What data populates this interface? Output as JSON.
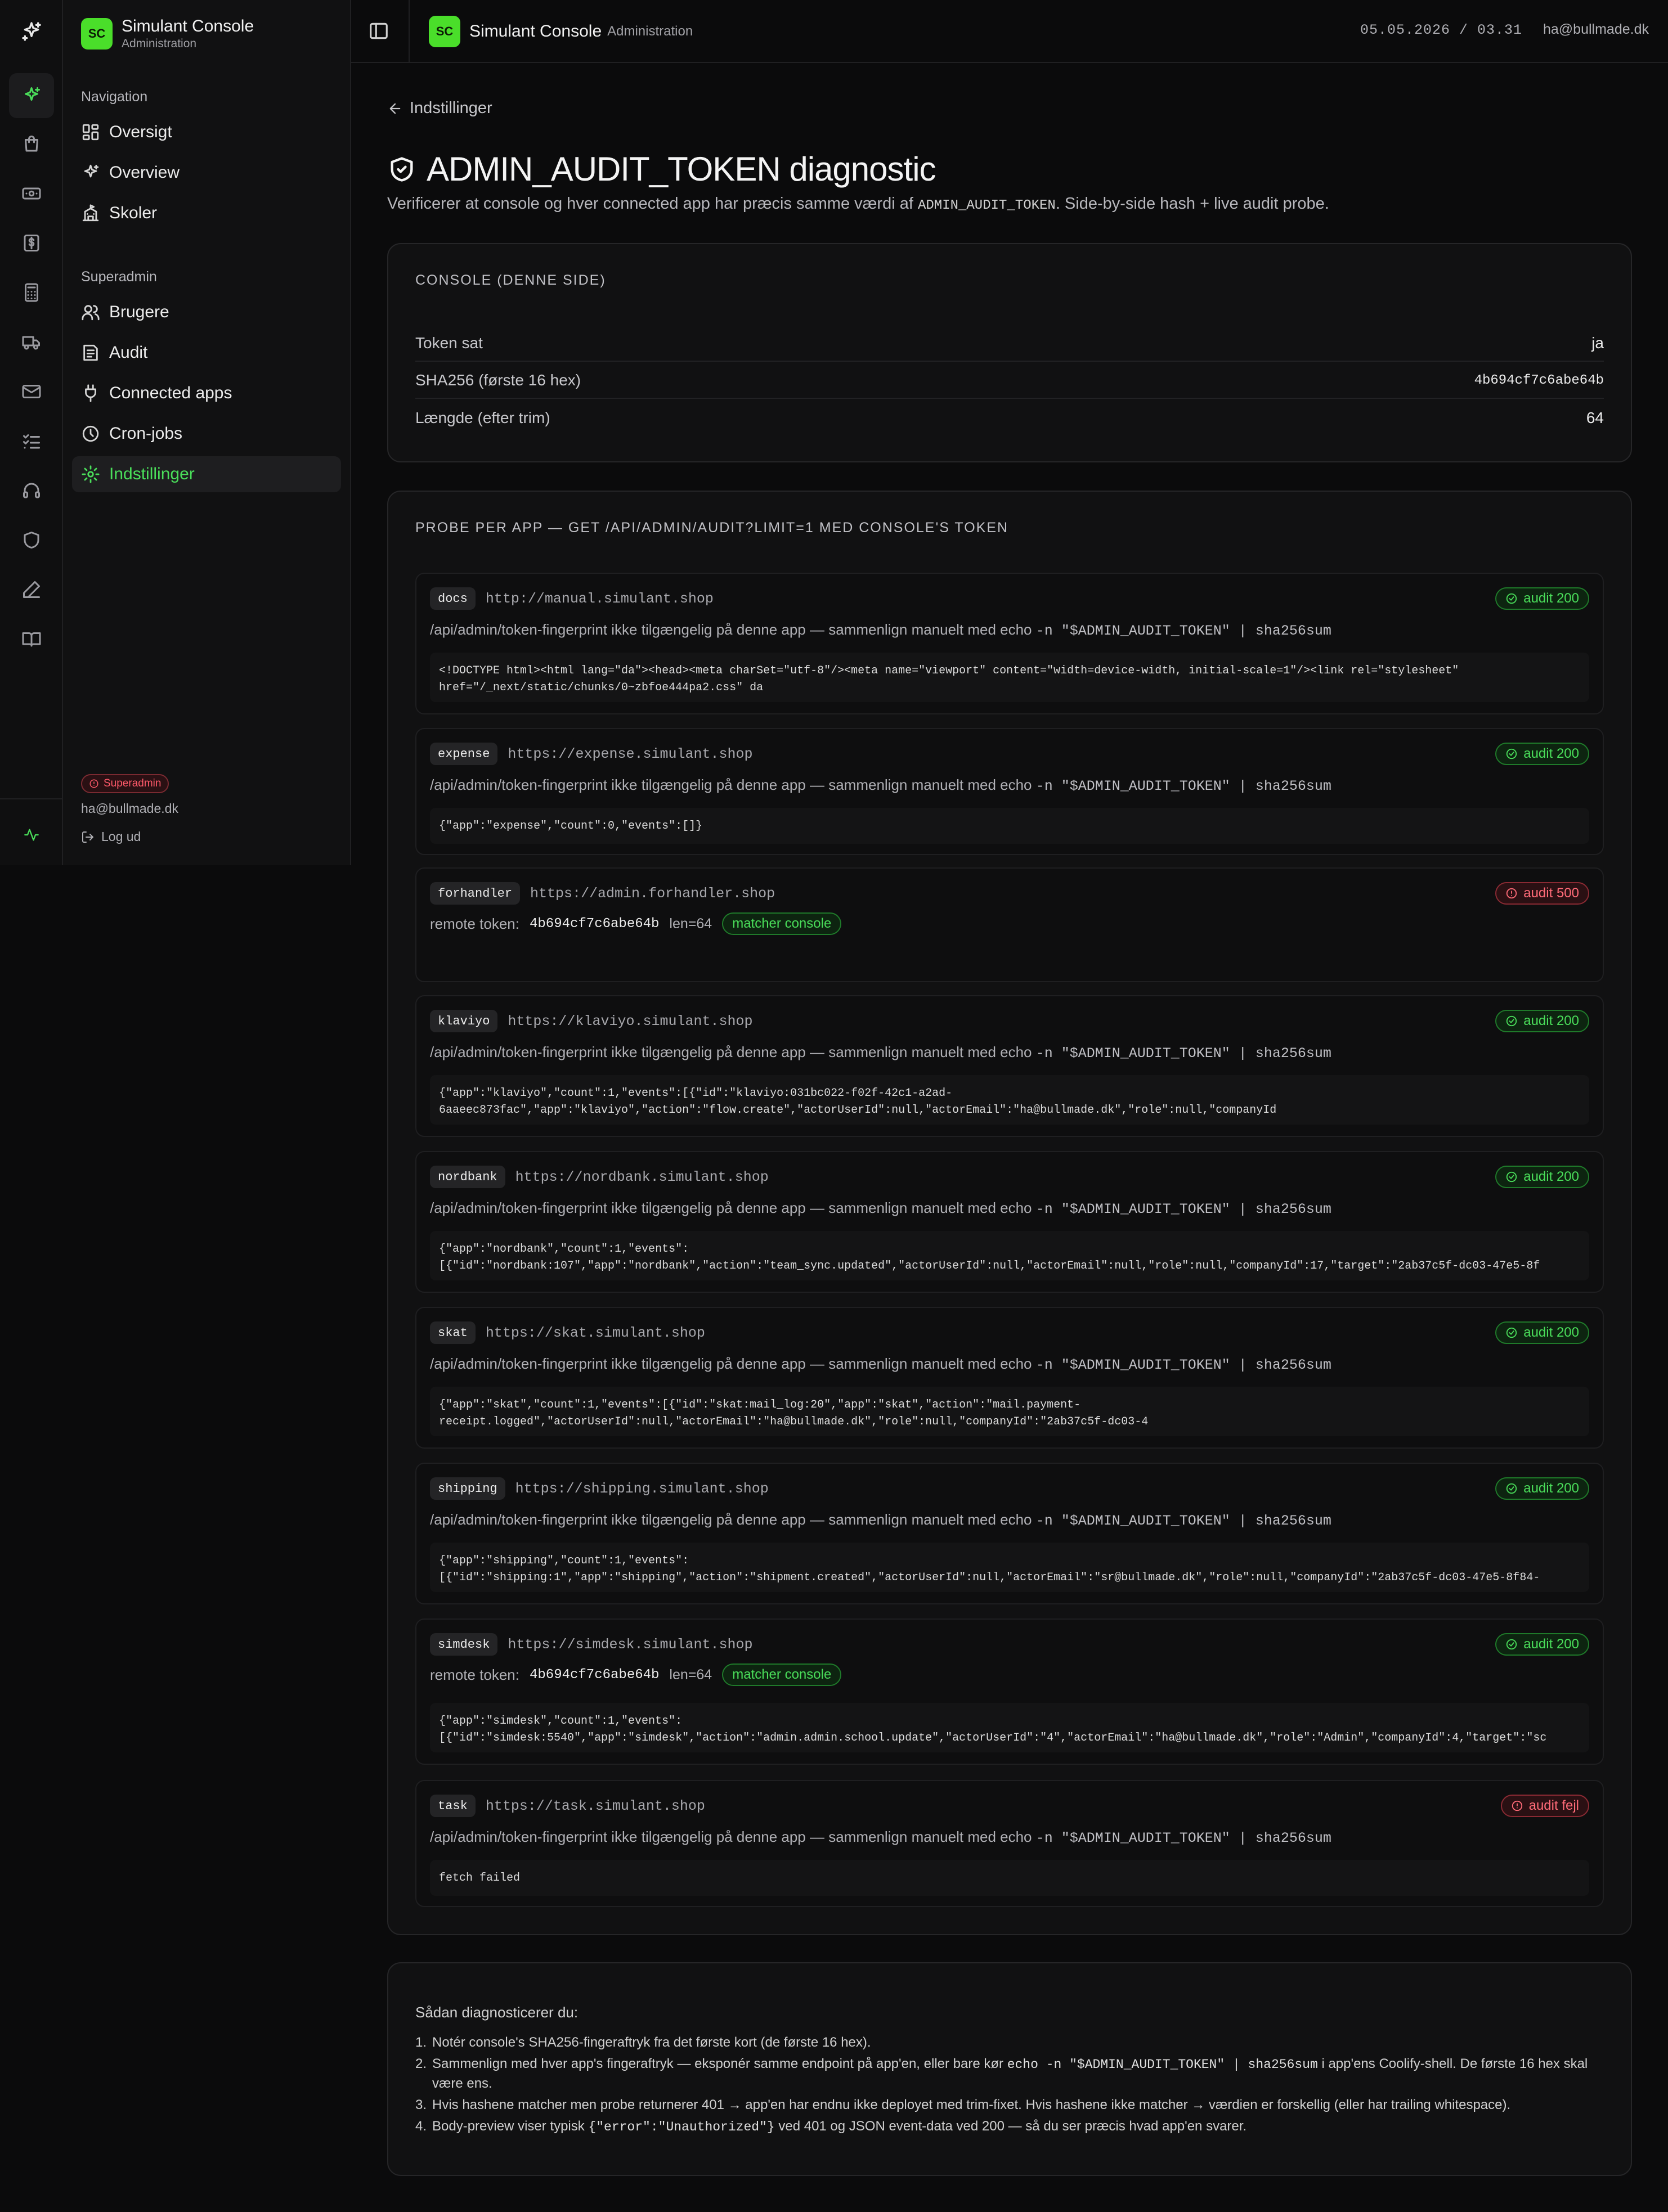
{
  "app": {
    "title": "Simulant Console",
    "subtitle": "Administration",
    "initials": "SC"
  },
  "header": {
    "title": "Simulant Console",
    "subtitle": "Administration",
    "datetime": "05.05.2026 / 03.31",
    "user_email": "ha@bullmade.dk"
  },
  "sidebar": {
    "navigation_label": "Navigation",
    "navigation": [
      {
        "label": "Oversigt",
        "icon": "dashboard-icon"
      },
      {
        "label": "Overview",
        "icon": "sparkle-icon"
      },
      {
        "label": "Skoler",
        "icon": "school-icon"
      }
    ],
    "superadmin_label": "Superadmin",
    "superadmin": [
      {
        "label": "Brugere",
        "icon": "users-icon"
      },
      {
        "label": "Audit",
        "icon": "audit-icon"
      },
      {
        "label": "Connected apps",
        "icon": "plug-icon"
      },
      {
        "label": "Cron-jobs",
        "icon": "clock-icon"
      },
      {
        "label": "Indstillinger",
        "icon": "gear-icon",
        "active": true
      }
    ],
    "role_badge": "Superadmin",
    "user_email": "ha@bullmade.dk",
    "logout_label": "Log ud"
  },
  "rail_icons": [
    "sparkle-icon",
    "bag-icon",
    "banknote-icon",
    "dollar-icon",
    "calculator-icon",
    "truck-icon",
    "mail-icon",
    "checklist-icon",
    "headset-icon",
    "shield-icon",
    "pen-icon",
    "book-icon",
    "activity-icon"
  ],
  "page": {
    "back_label": "Indstillinger",
    "title": "ADMIN_AUDIT_TOKEN diagnostic",
    "lead_before": "Verificerer at console og hver connected app har præcis samme værdi af",
    "lead_code": "ADMIN_AUDIT_TOKEN",
    "lead_after": ". Side-by-side hash + live audit probe."
  },
  "console": {
    "heading": "CONSOLE (DENNE SIDE)",
    "rows": [
      {
        "key": "Token sat",
        "value": "ja"
      },
      {
        "key": "SHA256 (første 16 hex)",
        "value": "4b694cf7c6abe64b"
      },
      {
        "key": "Længde (efter trim)",
        "value": "64"
      }
    ]
  },
  "probe": {
    "heading": "PROBE PER APP — GET /API/ADMIN/AUDIT?LIMIT=1 MED CONSOLE'S TOKEN",
    "note_text": "/api/admin/token-fingerprint ikke tilgængelig på denne app — sammenlign manuelt med echo",
    "note_code": "-n \"$ADMIN_AUDIT_TOKEN\" | sha256sum",
    "remote_label": "remote token:",
    "match_label": "matcher console",
    "apps": [
      {
        "name": "docs",
        "url": "http://manual.simulant.shop",
        "status": "audit 200",
        "body": "<!DOCTYPE html><html lang=\"da\"><head><meta charSet=\"utf-8\"/><meta name=\"viewport\" content=\"width=device-width, initial-scale=1\"/><link rel=\"stylesheet\"\nhref=\"/_next/static/chunks/0~zbfoe444pa2.css\" da"
      },
      {
        "name": "expense",
        "url": "https://expense.simulant.shop",
        "status": "audit 200",
        "body": "{\"app\":\"expense\",\"count\":0,\"events\":[]}"
      },
      {
        "name": "forhandler",
        "url": "https://admin.forhandler.shop",
        "status": "audit 500",
        "remote_token": "4b694cf7c6abe64b",
        "len": "len=64"
      },
      {
        "name": "klaviyo",
        "url": "https://klaviyo.simulant.shop",
        "status": "audit 200",
        "body": "{\"app\":\"klaviyo\",\"count\":1,\"events\":[{\"id\":\"klaviyo:031bc022-f02f-42c1-a2ad-\n6aaeec873fac\",\"app\":\"klaviyo\",\"action\":\"flow.create\",\"actorUserId\":null,\"actorEmail\":\"ha@bullmade.dk\",\"role\":null,\"companyId"
      },
      {
        "name": "nordbank",
        "url": "https://nordbank.simulant.shop",
        "status": "audit 200",
        "body": "{\"app\":\"nordbank\",\"count\":1,\"events\":\n[{\"id\":\"nordbank:107\",\"app\":\"nordbank\",\"action\":\"team_sync.updated\",\"actorUserId\":null,\"actorEmail\":null,\"role\":null,\"companyId\":17,\"target\":\"2ab37c5f-dc03-47e5-8f"
      },
      {
        "name": "skat",
        "url": "https://skat.simulant.shop",
        "status": "audit 200",
        "body": "{\"app\":\"skat\",\"count\":1,\"events\":[{\"id\":\"skat:mail_log:20\",\"app\":\"skat\",\"action\":\"mail.payment-\nreceipt.logged\",\"actorUserId\":null,\"actorEmail\":\"ha@bullmade.dk\",\"role\":null,\"companyId\":\"2ab37c5f-dc03-4"
      },
      {
        "name": "shipping",
        "url": "https://shipping.simulant.shop",
        "status": "audit 200",
        "body": "{\"app\":\"shipping\",\"count\":1,\"events\":\n[{\"id\":\"shipping:1\",\"app\":\"shipping\",\"action\":\"shipment.created\",\"actorUserId\":null,\"actorEmail\":\"sr@bullmade.dk\",\"role\":null,\"companyId\":\"2ab37c5f-dc03-47e5-8f84-"
      },
      {
        "name": "simdesk",
        "url": "https://simdesk.simulant.shop",
        "status": "audit 200",
        "remote_token": "4b694cf7c6abe64b",
        "len": "len=64",
        "body": "{\"app\":\"simdesk\",\"count\":1,\"events\":\n[{\"id\":\"simdesk:5540\",\"app\":\"simdesk\",\"action\":\"admin.admin.school.update\",\"actorUserId\":\"4\",\"actorEmail\":\"ha@bullmade.dk\",\"role\":\"Admin\",\"companyId\":4,\"target\":\"sc"
      },
      {
        "name": "task",
        "url": "https://task.simulant.shop",
        "status": "audit fejl",
        "body": "fetch failed"
      }
    ]
  },
  "howto": {
    "heading": "Sådan diagnosticerer du:",
    "steps": [
      {
        "n": "1.",
        "text": "Notér console's SHA256-fingeraftryk fra det første kort (de første 16 hex)."
      },
      {
        "n": "2.",
        "a": "Sammenlign med hver app's fingeraftryk — eksponér samme endpoint på app'en, eller bare kør",
        "code": "echo -n \"$ADMIN_AUDIT_TOKEN\" | sha256sum",
        "b": "i app'ens Coolify-shell. De første 16 hex skal være ens."
      },
      {
        "n": "3.",
        "text": "Hvis hashene matcher men probe returnerer 401 → app'en har endnu ikke deployet med trim-fixet. Hvis hashene ikke matcher → værdien er forskellig (eller har trailing whitespace)."
      },
      {
        "n": "4.",
        "a": "Body-preview viser typisk",
        "code": "{\"error\":\"Unauthorized\"}",
        "b": "ved 401 og JSON event-data ved 200 — så du ser præcis hvad app'en svarer."
      }
    ]
  },
  "colors": {
    "accent": "#4ade5a",
    "ok": "#4ade5a",
    "error": "#ff6b78",
    "background": "#0b0b0c"
  }
}
